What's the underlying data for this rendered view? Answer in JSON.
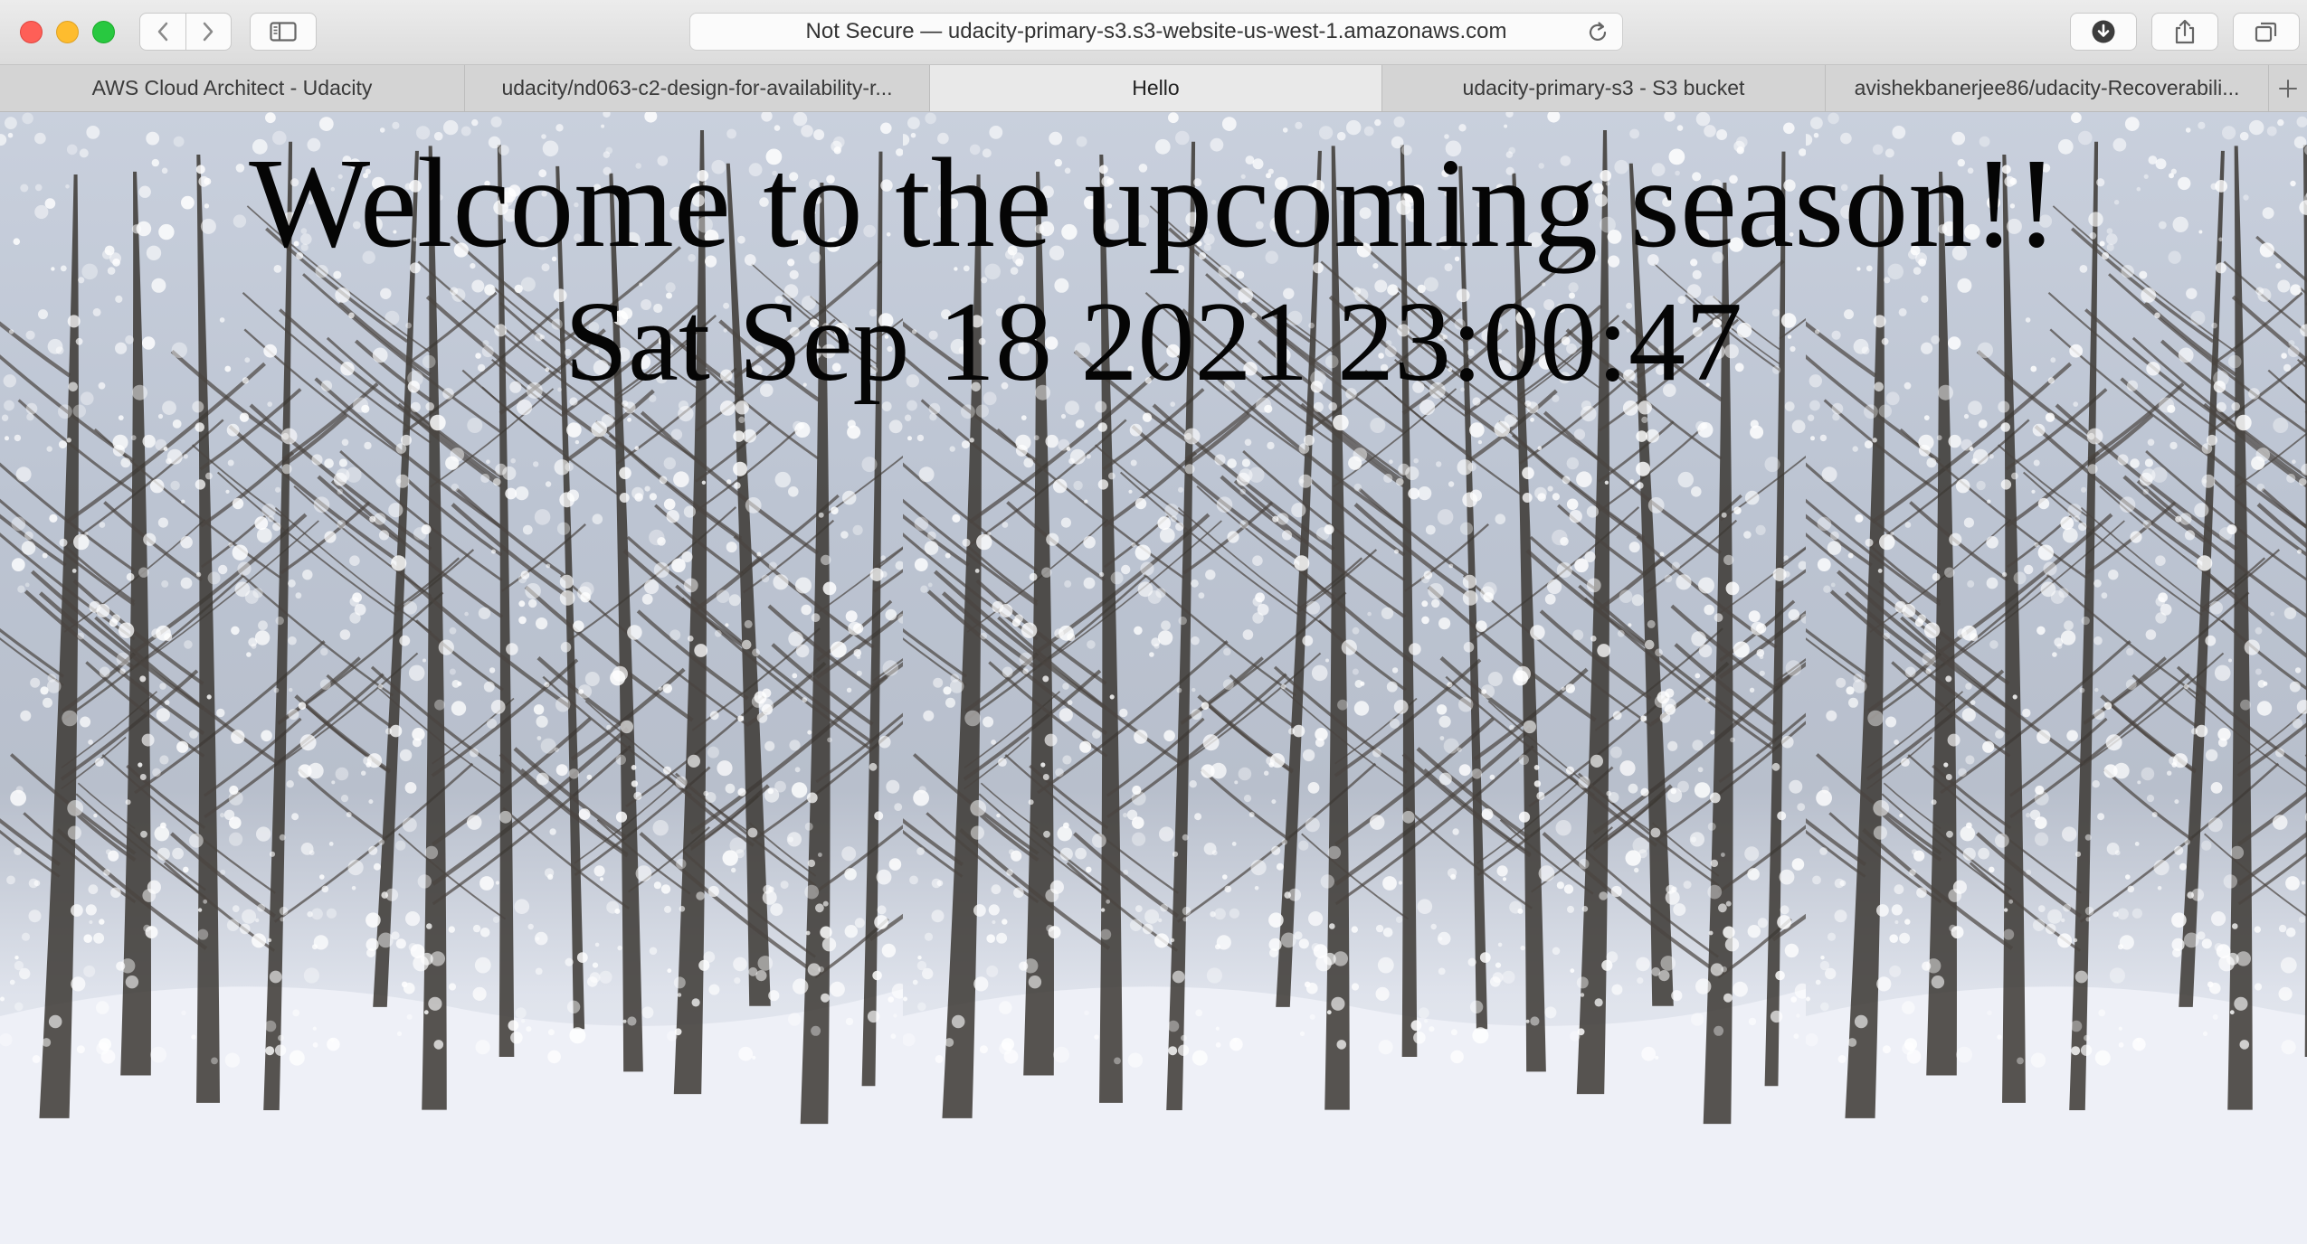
{
  "browser": {
    "address_bar": "Not Secure — udacity-primary-s3.s3-website-us-west-1.amazonaws.com",
    "tabs": [
      {
        "label": "AWS Cloud Architect - Udacity"
      },
      {
        "label": "udacity/nd063-c2-design-for-availability-r..."
      },
      {
        "label": "Hello"
      },
      {
        "label": "udacity-primary-s3 - S3 bucket"
      },
      {
        "label": "avishekbanerjee86/udacity-Recoverabili..."
      }
    ],
    "active_tab": 2
  },
  "page": {
    "heading": "Welcome to the upcoming season!!",
    "timestamp": "Sat Sep 18 2021 23:00:47"
  },
  "icons": {
    "back": "chevron-left-icon",
    "forward": "chevron-right-icon",
    "sidebar": "sidebar-icon",
    "reload": "reload-icon",
    "download": "download-icon",
    "share": "share-icon",
    "tabs": "tabs-overview-icon",
    "new_tab": "plus-icon"
  },
  "colors": {
    "close": "#fe5f57",
    "minimize": "#febc2e",
    "zoom": "#28c840"
  }
}
